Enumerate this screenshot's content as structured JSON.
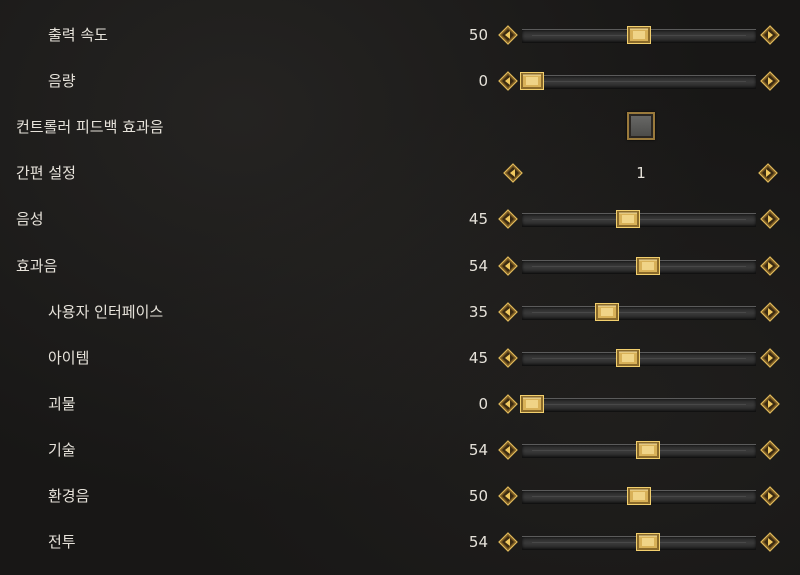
{
  "settings": [
    {
      "label": "출력 속도",
      "indent": 1,
      "type": "slider",
      "value": 50
    },
    {
      "label": "음량",
      "indent": 1,
      "type": "slider",
      "value": 0
    },
    {
      "label": "컨트롤러 피드백 효과음",
      "indent": 0,
      "type": "checkbox",
      "checked": false
    },
    {
      "label": "간편 설정",
      "indent": 0,
      "type": "stepper",
      "value": "1"
    },
    {
      "label": "음성",
      "indent": 0,
      "type": "slider",
      "value": 45
    },
    {
      "label": "효과음",
      "indent": 0,
      "type": "slider",
      "value": 54
    },
    {
      "label": "사용자 인터페이스",
      "indent": 1,
      "type": "slider",
      "value": 35
    },
    {
      "label": "아이템",
      "indent": 1,
      "type": "slider",
      "value": 45
    },
    {
      "label": "괴물",
      "indent": 1,
      "type": "slider",
      "value": 0
    },
    {
      "label": "기술",
      "indent": 1,
      "type": "slider",
      "value": 54
    },
    {
      "label": "환경음",
      "indent": 1,
      "type": "slider",
      "value": 50
    },
    {
      "label": "전투",
      "indent": 1,
      "type": "slider",
      "value": 54
    }
  ],
  "slider_range": [
    0,
    100
  ],
  "icons": {
    "decrease": "diamond-arrow-left-icon",
    "increase": "diamond-arrow-right-icon",
    "handle": "gold-handle-icon"
  },
  "colors": {
    "gold": "#c9a24a",
    "background": "#181716",
    "text": "#e6e2da"
  }
}
